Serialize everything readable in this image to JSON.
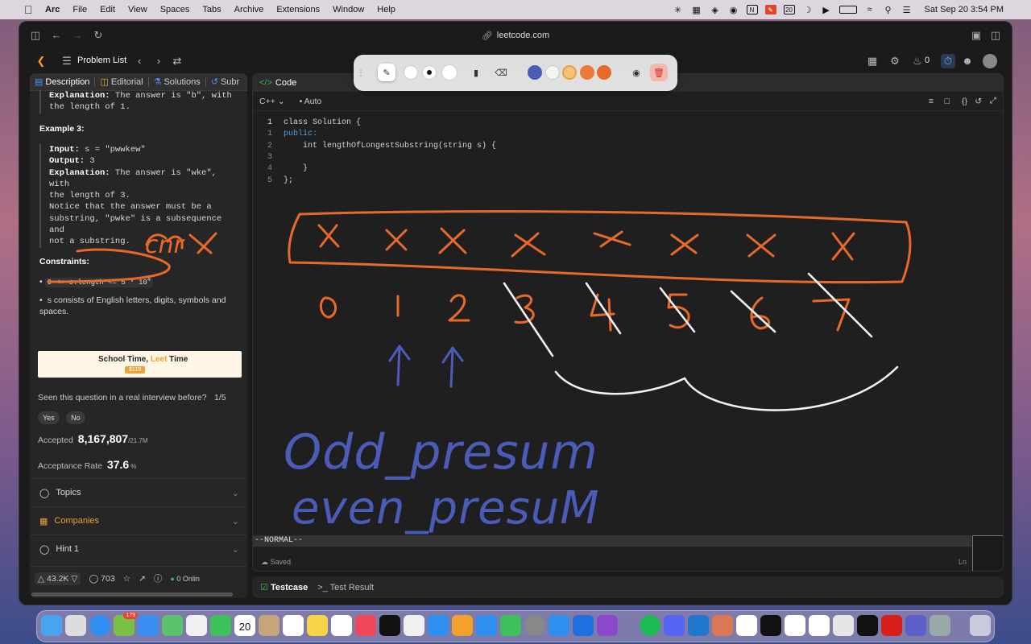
{
  "menubar": {
    "app": "Arc",
    "menus": [
      "File",
      "Edit",
      "View",
      "Spaces",
      "Tabs",
      "Archive",
      "Extensions",
      "Window",
      "Help"
    ],
    "date_badge": "20",
    "clock": "Sat Sep 20  3:54 PM"
  },
  "browser": {
    "url": "leetcode.com"
  },
  "header": {
    "problem_list": "Problem List",
    "streak_count": "0"
  },
  "left_tabs": [
    "Description",
    "Editorial",
    "Solutions",
    "Subr"
  ],
  "description": {
    "example2_explanation_label": "Explanation:",
    "example2_explanation": " The answer is \"b\", with",
    "example2_explanation_cont": "the length of 1.",
    "example3_title": "Example 3:",
    "example3_input_label": "Input:",
    "example3_input": " s = \"pwwkew\"",
    "example3_output_label": "Output:",
    "example3_output": " 3",
    "example3_explanation_label": "Explanation:",
    "example3_explanation_lines": [
      " The answer is \"wke\", with",
      "the length of 3.",
      "Notice that the answer must be a",
      "substring, \"pwke\" is a subsequence and",
      "not a substring."
    ],
    "constraints_title": "Constraints:",
    "constraint1": "0 <= s.length <= 5 * 10",
    "constraint1_sup": "4",
    "constraint2": "s consists of English letters, digits, symbols and spaces."
  },
  "banner": {
    "text_a": "School Time, ",
    "text_b": "Leet",
    "text_c": " Time",
    "price": "$119"
  },
  "interview": {
    "question": "Seen this question in a real interview before?",
    "count": "1/5",
    "yes": "Yes",
    "no": "No"
  },
  "stats": {
    "accepted_label": "Accepted",
    "accepted_value": "8,167,807",
    "accepted_total": "/21.7M",
    "acceptance_label": "Acceptance Rate",
    "acceptance_value": "37.6",
    "acceptance_unit": "%"
  },
  "sections": [
    "Topics",
    "Companies",
    "Hint 1"
  ],
  "footer": {
    "likes": "43.2K",
    "comments": "703",
    "online": "0 Onlin"
  },
  "code_panel": {
    "tab": "Code",
    "language": "C++",
    "mode": "Auto",
    "lines": [
      {
        "num": "1",
        "text": "class Solution {"
      },
      {
        "num": "1",
        "text": "public:"
      },
      {
        "num": "2",
        "text": "    int lengthOfLongestSubstring(string s) {"
      },
      {
        "num": "3",
        "text": ""
      },
      {
        "num": "4",
        "text": "    }"
      },
      {
        "num": "5",
        "text": "};"
      }
    ],
    "vim_mode": "--NORMAL--",
    "saved": "Saved",
    "cursor": "Ln"
  },
  "bottom_tabs": {
    "testcase": "Testcase",
    "result": "Test Result"
  },
  "annotations": {
    "indices": [
      "0",
      "1",
      "2",
      "3",
      "4",
      "5",
      "6",
      "7"
    ],
    "word1": "Odd_presum",
    "word2": "even_presuM",
    "near_constraints": "cnr"
  },
  "colors": {
    "accent_orange": "#e8692a",
    "ink_blue": "#4b5bb8",
    "ink_white": "#f2f2f2",
    "accepted_green": "#2cbb5d"
  },
  "dock": {
    "calendar_day": "20",
    "mail_badge": "179"
  }
}
